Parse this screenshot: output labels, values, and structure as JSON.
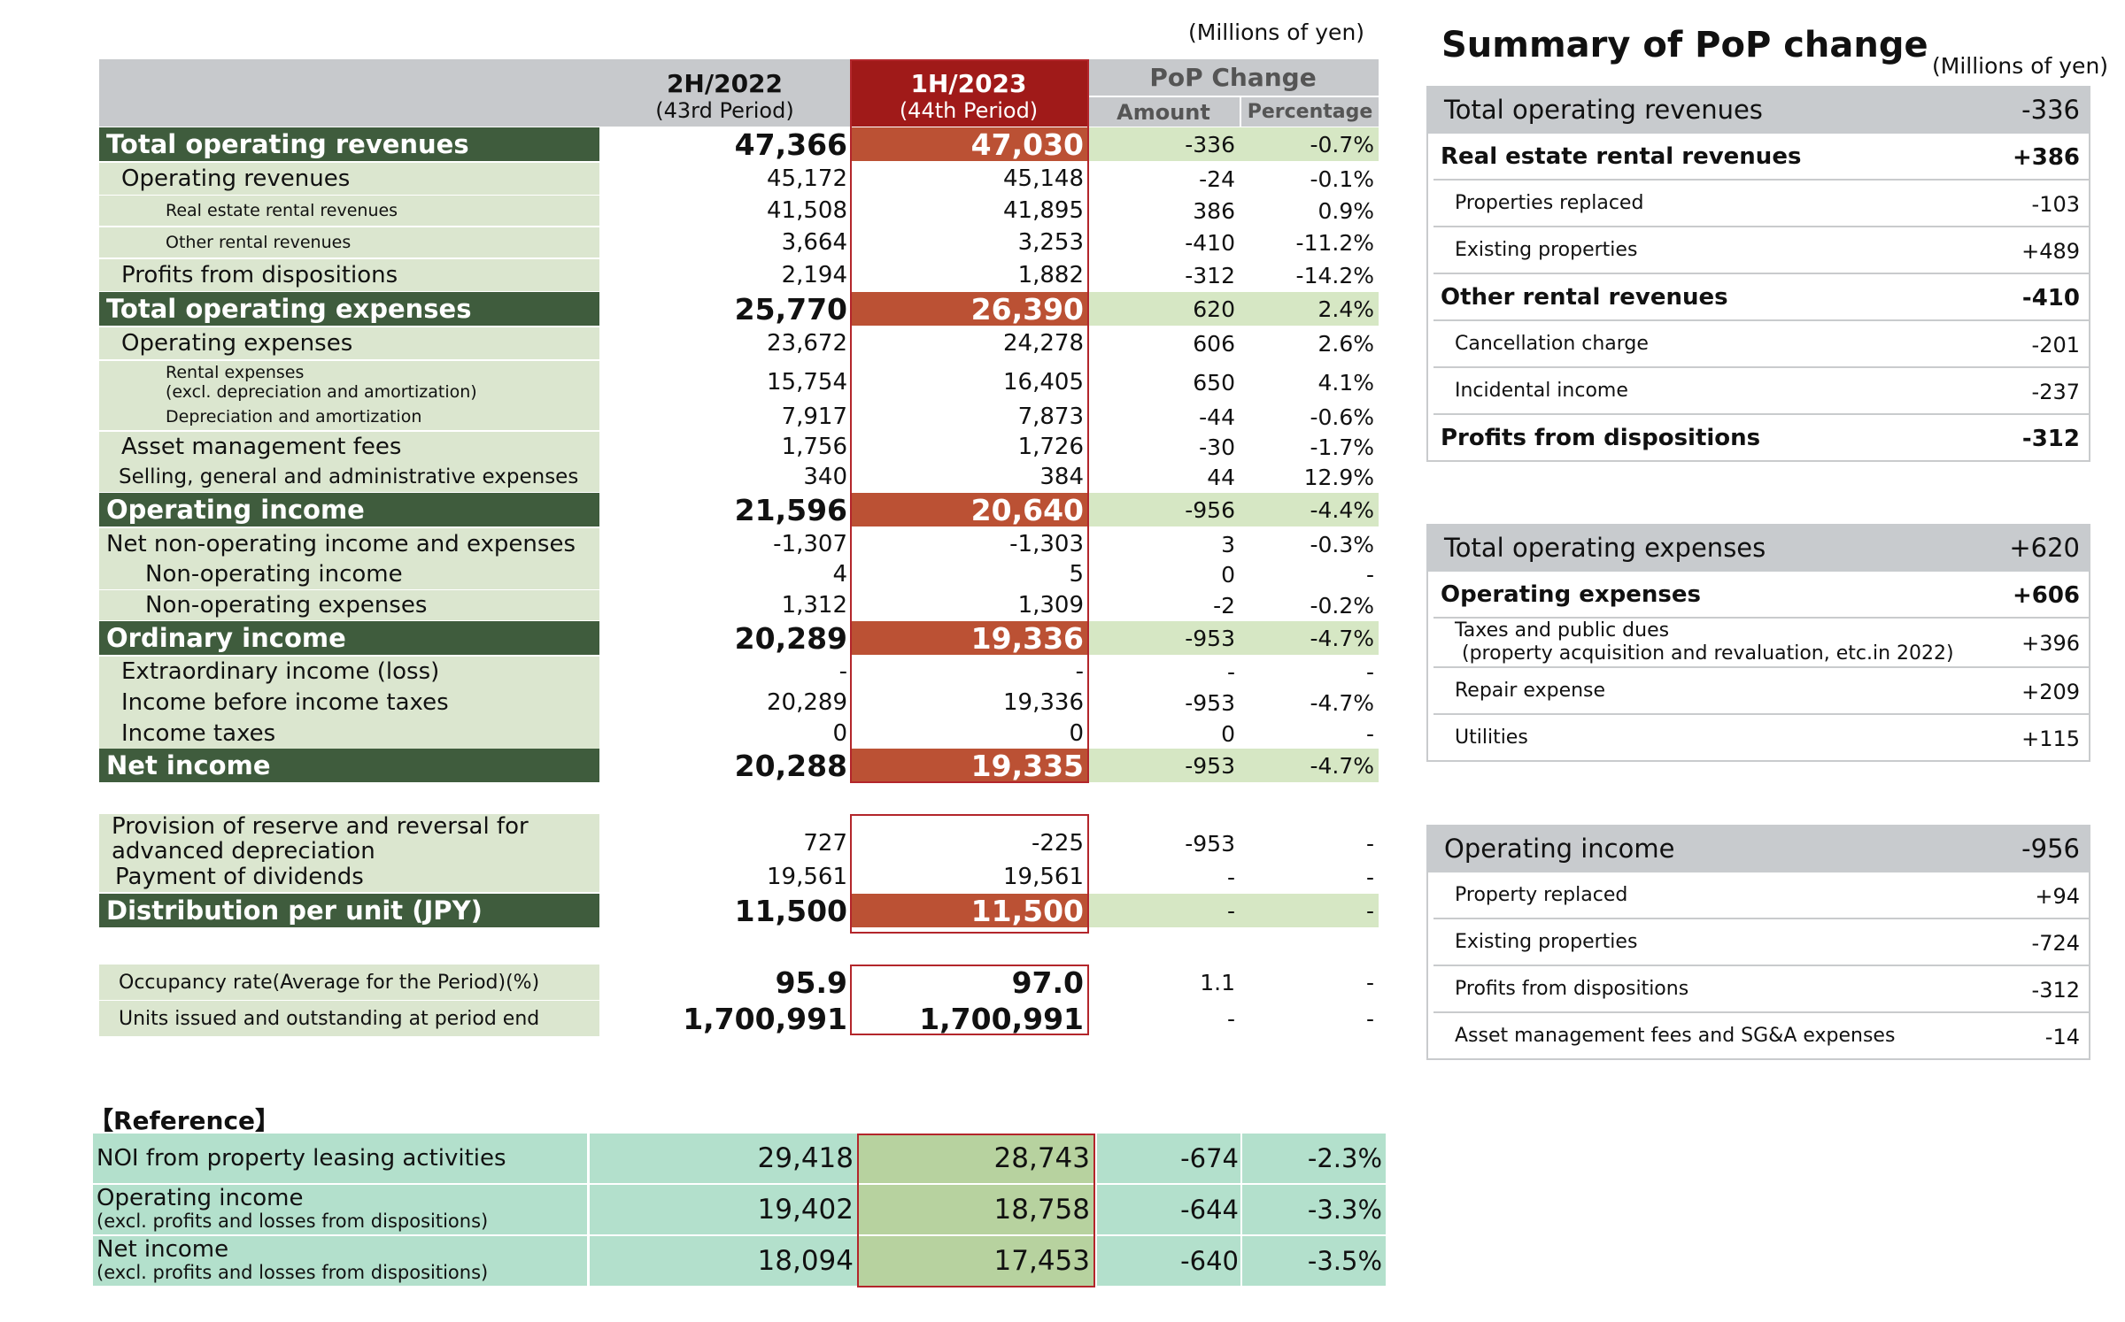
{
  "units_left": "(Millions of yen)",
  "header": {
    "col1_title": "2H/2022",
    "col1_sub": "(43rd Period)",
    "col2_title": "1H/2023",
    "col2_sub": "(44th Period)",
    "pop_title": "PoP Change",
    "amount": "Amount",
    "percentage": "Percentage"
  },
  "rows": [
    {
      "label": "Total operating revenues",
      "v1": "47,366",
      "v2": "47,030",
      "amt": "-336",
      "pct": "-0.7%"
    },
    {
      "label": "Operating revenues",
      "v1": "45,172",
      "v2": "45,148",
      "amt": "-24",
      "pct": "-0.1%"
    },
    {
      "label": "Real estate rental revenues",
      "v1": "41,508",
      "v2": "41,895",
      "amt": "386",
      "pct": "0.9%"
    },
    {
      "label": "Other rental revenues",
      "v1": "3,664",
      "v2": "3,253",
      "amt": "-410",
      "pct": "-11.2%"
    },
    {
      "label": "Profits from dispositions",
      "v1": "2,194",
      "v2": "1,882",
      "amt": "-312",
      "pct": "-14.2%"
    },
    {
      "label": "Total operating expenses",
      "v1": "25,770",
      "v2": "26,390",
      "amt": "620",
      "pct": "2.4%"
    },
    {
      "label": "Operating expenses",
      "v1": "23,672",
      "v2": "24,278",
      "amt": "606",
      "pct": "2.6%"
    },
    {
      "label": "Rental expenses",
      "label2": "(excl. depreciation and amortization)",
      "v1": "15,754",
      "v2": "16,405",
      "amt": "650",
      "pct": "4.1%"
    },
    {
      "label": "Depreciation and amortization",
      "v1": "7,917",
      "v2": "7,873",
      "amt": "-44",
      "pct": "-0.6%"
    },
    {
      "label": "Asset management fees",
      "v1": "1,756",
      "v2": "1,726",
      "amt": "-30",
      "pct": "-1.7%"
    },
    {
      "label": "Selling, general and administrative expenses",
      "v1": "340",
      "v2": "384",
      "amt": "44",
      "pct": "12.9%"
    },
    {
      "label": "Operating income",
      "v1": "21,596",
      "v2": "20,640",
      "amt": "-956",
      "pct": "-4.4%"
    },
    {
      "label": "Net non-operating income and expenses",
      "v1": "-1,307",
      "v2": "-1,303",
      "amt": "3",
      "pct": "-0.3%"
    },
    {
      "label": "Non-operating income",
      "v1": "4",
      "v2": "5",
      "amt": "0",
      "pct": "-"
    },
    {
      "label": "Non-operating expenses",
      "v1": "1,312",
      "v2": "1,309",
      "amt": "-2",
      "pct": "-0.2%"
    },
    {
      "label": "Ordinary income",
      "v1": "20,289",
      "v2": "19,336",
      "amt": "-953",
      "pct": "-4.7%"
    },
    {
      "label": "Extraordinary income (loss)",
      "v1": "-",
      "v2": "-",
      "amt": "-",
      "pct": "-"
    },
    {
      "label": "Income before income taxes",
      "v1": "20,289",
      "v2": "19,336",
      "amt": "-953",
      "pct": "-4.7%"
    },
    {
      "label": "Income taxes",
      "v1": "0",
      "v2": "0",
      "amt": "0",
      "pct": "-"
    },
    {
      "label": "Net income",
      "v1": "20,288",
      "v2": "19,335",
      "amt": "-953",
      "pct": "-4.7%"
    }
  ],
  "dist": [
    {
      "label": "Provision of reserve and reversal for",
      "label2": "advanced depreciation",
      "v1": "727",
      "v2": "-225",
      "amt": "-953",
      "pct": "-"
    },
    {
      "label": "Payment of dividends",
      "v1": "19,561",
      "v2": "19,561",
      "amt": "-",
      "pct": "-"
    },
    {
      "label": "Distribution per unit (JPY)",
      "v1": "11,500",
      "v2": "11,500",
      "amt": "-",
      "pct": "-"
    }
  ],
  "occ": [
    {
      "label": "Occupancy rate(Average for the Period)(%)",
      "v1": "95.9",
      "v2": "97.0",
      "amt": "1.1",
      "pct": "-"
    },
    {
      "label": "Units issued and outstanding at period end",
      "v1": "1,700,991",
      "v2": "1,700,991",
      "amt": "-",
      "pct": "-"
    }
  ],
  "reference": {
    "title": "【Reference】",
    "rows": [
      {
        "label": "NOI from property leasing activities",
        "v1": "29,418",
        "v2": "28,743",
        "amt": "-674",
        "pct": "-2.3%"
      },
      {
        "label": "Operating income",
        "label2": "(excl. profits and losses from dispositions)",
        "v1": "19,402",
        "v2": "18,758",
        "amt": "-644",
        "pct": "-3.3%"
      },
      {
        "label": "Net income",
        "label2": "(excl. profits and losses from dispositions)",
        "v1": "18,094",
        "v2": "17,453",
        "amt": "-640",
        "pct": "-3.5%"
      }
    ]
  },
  "summary": {
    "title": "Summary of PoP change",
    "units": "(Millions of yen)",
    "box1": {
      "header": {
        "label": "Total operating revenues",
        "value": "-336"
      },
      "rows": [
        {
          "label": "Real estate rental revenues",
          "value": "+386",
          "bold": true
        },
        {
          "label": "Properties replaced",
          "value": "-103"
        },
        {
          "label": "Existing properties",
          "value": "+489"
        },
        {
          "label": "Other rental revenues",
          "value": "-410",
          "bold": true
        },
        {
          "label": "Cancellation charge",
          "value": "-201"
        },
        {
          "label": "Incidental income",
          "value": "-237"
        },
        {
          "label": "Profits from dispositions",
          "value": "-312",
          "bold": true
        }
      ]
    },
    "box2": {
      "header": {
        "label": "Total operating expenses",
        "value": "+620"
      },
      "rows": [
        {
          "label": "Operating expenses",
          "value": "+606",
          "bold": true
        },
        {
          "label": "Taxes and public dues",
          "label2": "(property acquisition and revaluation, etc.in 2022)",
          "value": "+396"
        },
        {
          "label": "Repair expense",
          "value": "+209"
        },
        {
          "label": "Utilities",
          "value": "+115"
        }
      ]
    },
    "box3": {
      "header": {
        "label": "Operating income",
        "value": "-956"
      },
      "rows": [
        {
          "label": "Property replaced",
          "value": "+94"
        },
        {
          "label": "Existing properties",
          "value": "-724"
        },
        {
          "label": "Profits from dispositions",
          "value": "-312"
        },
        {
          "label": "Asset management fees and SG&A expenses",
          "value": "-14"
        }
      ]
    }
  }
}
